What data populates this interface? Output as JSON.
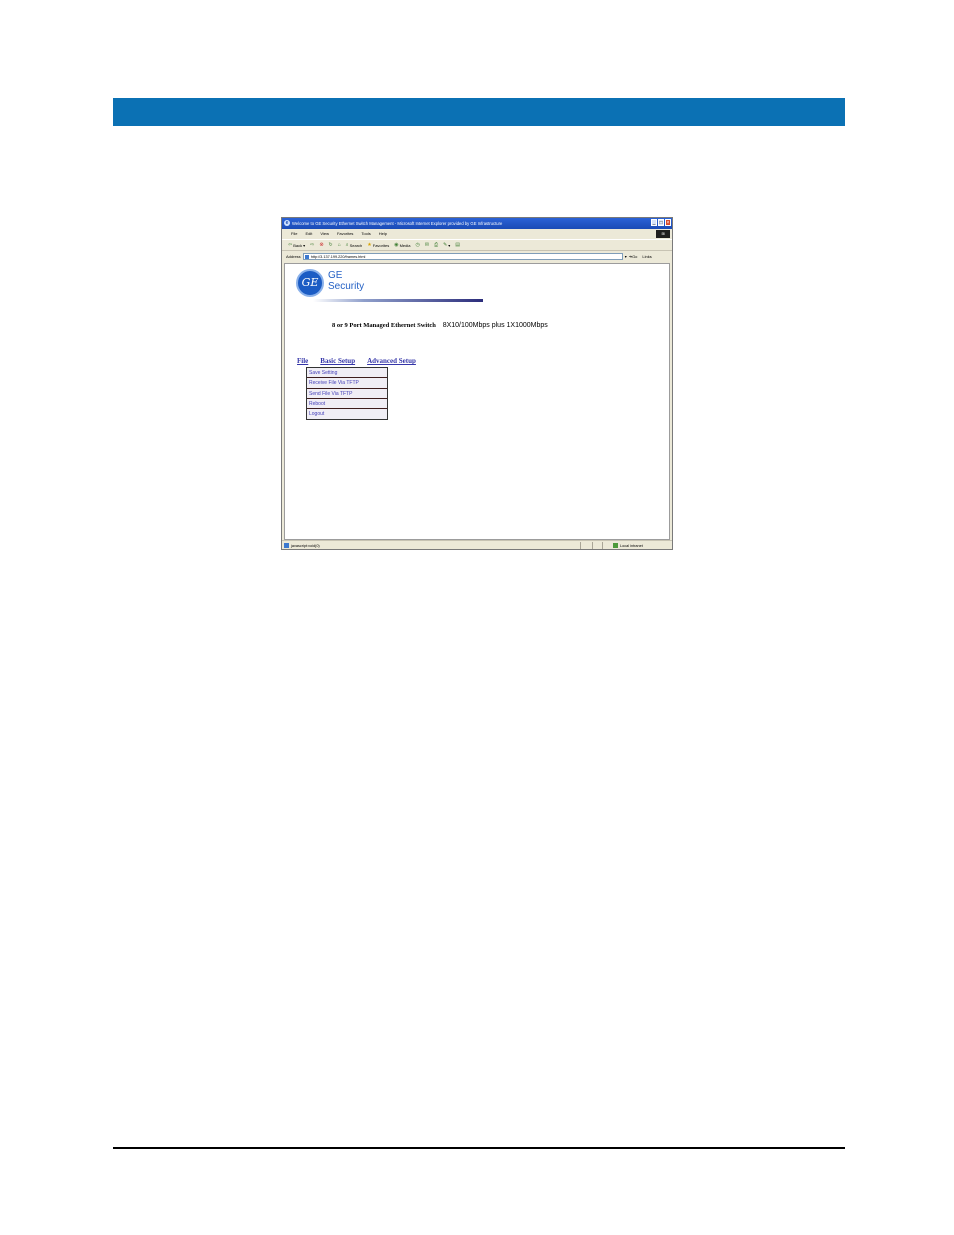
{
  "document": {
    "header_bar_color": "#0b71b4"
  },
  "browser": {
    "title": "Welcome to GE Security Ethernet Switch Management - Microsoft Internet Explorer provided by GE Infrastructure",
    "menu": [
      "File",
      "Edit",
      "View",
      "Favorites",
      "Tools",
      "Help"
    ],
    "toolbar": {
      "back": "Back",
      "search": "Search",
      "favorites": "Favorites",
      "media": "Media"
    },
    "address": {
      "label": "Address",
      "url": "http://3.137.199.220/frames.html",
      "go": "Go",
      "links": "Links"
    },
    "status": {
      "text": "javascript:void(0)",
      "zone": "Local intranet"
    }
  },
  "page": {
    "logo": {
      "monogram": "GE",
      "line1": "GE",
      "line2": "Security"
    },
    "product_title": "8 or 9 Port Managed Ethernet Switch",
    "product_spec": "8X10/100Mbps plus 1X1000Mbps",
    "nav": {
      "file": "File",
      "basic": "Basic Setup",
      "advanced": "Advanced Setup"
    },
    "file_menu": [
      "Save Setting",
      "Receive File Via TFTP",
      "Send File Via TFTP",
      "Reboot",
      "Logout"
    ]
  }
}
